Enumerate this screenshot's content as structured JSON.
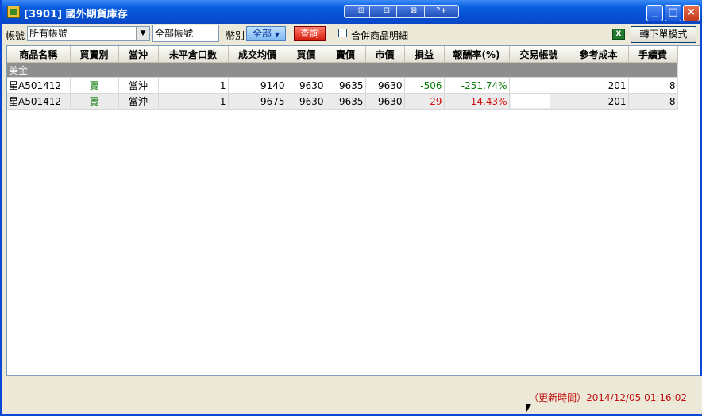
{
  "window": {
    "title": "[3901] 國外期貨庫存",
    "title_buttons": [
      "⊞",
      "⊟",
      "⊠",
      "?+"
    ],
    "controls": {
      "minimize": "_",
      "maximize": "□",
      "close": "×"
    }
  },
  "toolbar": {
    "account_label": "帳號",
    "account_value": "所有帳號",
    "account_name_value": "全部帳號",
    "currency_label": "幣別",
    "currency_value": "全部",
    "query_label": "查詢",
    "merge_label": "合併商品明細",
    "excel_icon": "X",
    "order_mode_label": "轉下單模式"
  },
  "table": {
    "columns": [
      "商品名稱",
      "買賣別",
      "當沖",
      "未平倉口數",
      "成交均價",
      "買價",
      "賣價",
      "市價",
      "損益",
      "報酬率(%)",
      "交易帳號",
      "參考成本",
      "手續費"
    ],
    "group_label": "美金",
    "rows": [
      {
        "name": "星A501412",
        "side": "賣",
        "daytrade": "當沖",
        "qty": "1",
        "avg_price": "9140",
        "bid": "9630",
        "ask": "9635",
        "market": "9630",
        "pnl": "-506",
        "return": "-251.74%",
        "account": "",
        "ref_cost": "201",
        "fee": "8"
      },
      {
        "name": "星A501412",
        "side": "賣",
        "daytrade": "當沖",
        "qty": "1",
        "avg_price": "9675",
        "bid": "9630",
        "ask": "9635",
        "market": "9630",
        "pnl": "29",
        "return": "14.43%",
        "account": "",
        "ref_cost": "201",
        "fee": "8"
      }
    ]
  },
  "status": {
    "update_time": "（更新時間）2014/12/05 01:16:02"
  },
  "colors": {
    "title_bar": "#0a5ee0",
    "positive": "#d01010",
    "negative": "#0a7a0a",
    "group_row": "#8e8e8e"
  }
}
